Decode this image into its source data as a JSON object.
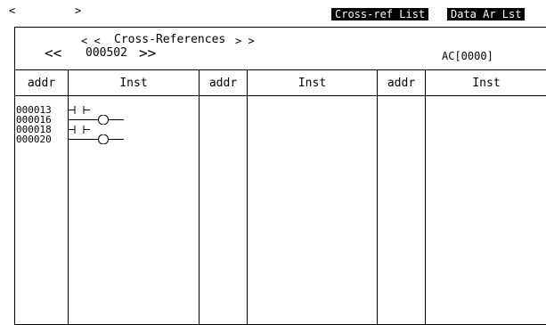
{
  "nav": {
    "prev": "<",
    "next": ">"
  },
  "tabs": [
    {
      "label": "Cross-ref List"
    },
    {
      "label": "Data Ar Lst"
    }
  ],
  "header": {
    "small_left": "< <",
    "title": "Cross-References",
    "small_right": "> >",
    "big_left": "<<",
    "address": "000502",
    "big_right": ">>",
    "ac_value": "AC[0000]"
  },
  "columns": [
    "addr",
    "Inst",
    "addr",
    "Inst",
    "addr",
    "Inst"
  ],
  "entries": [
    {
      "addr": "000013",
      "inst_icon": "no-contact-icon"
    },
    {
      "addr": "000016",
      "inst_icon": "output-coil-icon"
    },
    {
      "addr": "000018",
      "inst_icon": "no-contact-icon"
    },
    {
      "addr": "000020",
      "inst_icon": "output-coil-icon"
    }
  ]
}
